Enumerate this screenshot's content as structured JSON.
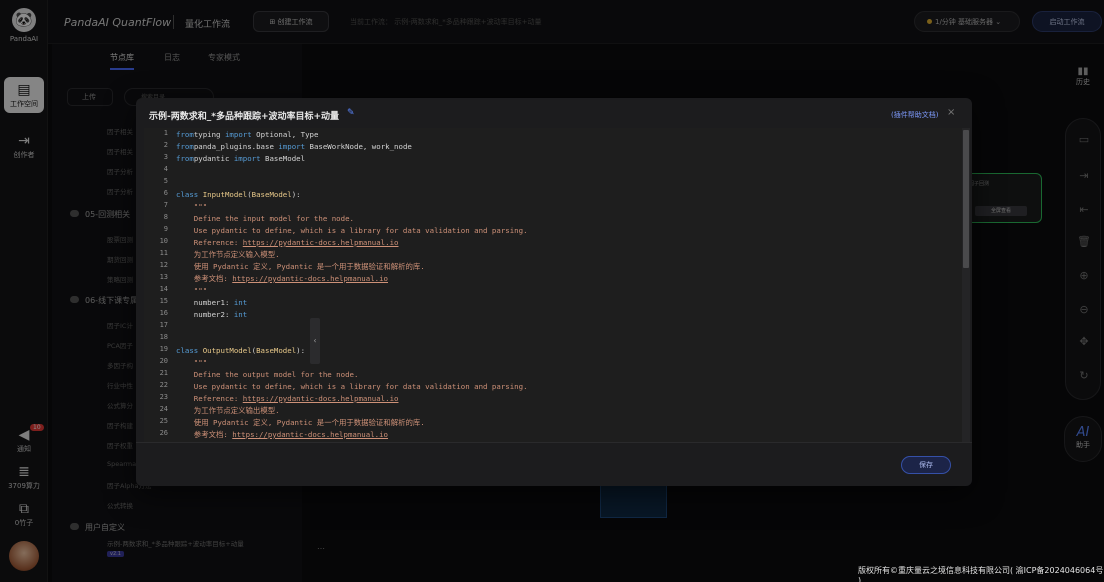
{
  "app": {
    "brand": "PandaAI",
    "title": "PandaAI QuantFlow",
    "subtitle": "量化工作流",
    "create_workflow": "创建工作流",
    "current_workflow": "当前工作流：  示例-两数求和_*多品种跟踪+波动率目标+动量",
    "server_label": "1/分钟  基础服务器",
    "start_workflow": "启动工作流"
  },
  "rail": {
    "workspace": "工作空间",
    "creator": "创作者",
    "notify": "通知",
    "notify_badge": "10",
    "compute": "3709算力",
    "bamboo": "0竹子"
  },
  "side": {
    "tabs": [
      "节点库",
      "日志",
      "专家模式"
    ],
    "upload": "上传",
    "search_placeholder": "搜索目录",
    "items_top": [
      "因子相关",
      "因子相关",
      "因子分析",
      "因子分析"
    ],
    "group_05": "05-回测相关",
    "items_05": [
      "股票回测",
      "期货回测",
      "策略回测"
    ],
    "group_06": "06-线下课专属",
    "items_06": [
      "因子IC计",
      "PCA因子",
      "多因子构",
      "行业中性",
      "公式算分",
      "因子构建",
      "因子权重",
      "Spearma",
      "因子Alpha方法",
      "公式转换"
    ],
    "group_user": "用户自定义",
    "user_item": "示例-两数求和_*多品种跟踪+波动率目标+动量",
    "user_tag": "v2.1",
    "more": "…"
  },
  "right": {
    "history": "历史",
    "assistant": "助手",
    "ai": "AI"
  },
  "canvas": {
    "node_title": "因子回测",
    "node_button": "全屏查看"
  },
  "footer": {
    "copyright": "版权所有©重庆量云之境信息科技有限公司( 渝ICP备2024046064号 )"
  },
  "modal": {
    "title": "示例-两数求和_*多品种跟踪+波动率目标+动量",
    "help": "(插件帮助文档)",
    "save": "保存",
    "close": "×",
    "edit": "✎",
    "collapse": "‹"
  },
  "code_lines": [
    [
      [
        "kw",
        "from"
      ],
      [
        "",
        "typing "
      ],
      [
        "kw",
        "import"
      ],
      [
        "",
        " Optional, Type"
      ]
    ],
    [
      [
        "kw",
        "from"
      ],
      [
        "",
        "panda_plugins.base "
      ],
      [
        "kw",
        "import"
      ],
      [
        "",
        " BaseWorkNode, work_node"
      ]
    ],
    [
      [
        "kw",
        "from"
      ],
      [
        "",
        "pydantic "
      ],
      [
        "kw",
        "import"
      ],
      [
        "",
        " BaseModel"
      ]
    ],
    [],
    [],
    [
      [
        "kw",
        "class"
      ],
      [
        "",
        " "
      ],
      [
        "cls",
        "InputModel"
      ],
      [
        "",
        "("
      ],
      [
        "cls",
        "BaseModel"
      ],
      [
        "",
        "):"
      ]
    ],
    [
      [
        "str",
        "    \"\"\""
      ]
    ],
    [
      [
        "str",
        "    Define the input model for the node."
      ]
    ],
    [
      [
        "str",
        "    Use pydantic to define, which is a library for data validation and parsing."
      ]
    ],
    [
      [
        "str",
        "    Reference: "
      ],
      [
        "url",
        "https://pydantic-docs.helpmanual.io"
      ]
    ],
    [
      [
        "str",
        "    为工作节点定义输入模型."
      ]
    ],
    [
      [
        "str",
        "    使用 Pydantic 定义, Pydantic 是一个用于数据验证和解析的库."
      ]
    ],
    [
      [
        "str",
        "    参考文档: "
      ],
      [
        "url",
        "https://pydantic-docs.helpmanual.io"
      ]
    ],
    [
      [
        "str",
        "    \"\"\""
      ]
    ],
    [
      [
        "",
        "    number1: "
      ],
      [
        "kw",
        "int"
      ]
    ],
    [
      [
        "",
        "    number2: "
      ],
      [
        "kw",
        "int"
      ]
    ],
    [],
    [],
    [
      [
        "kw",
        "class"
      ],
      [
        "",
        " "
      ],
      [
        "cls",
        "OutputModel"
      ],
      [
        "",
        "("
      ],
      [
        "cls",
        "BaseModel"
      ],
      [
        "",
        "):"
      ]
    ],
    [
      [
        "str",
        "    \"\"\""
      ]
    ],
    [
      [
        "str",
        "    Define the output model for the node."
      ]
    ],
    [
      [
        "str",
        "    Use pydantic to define, which is a library for data validation and parsing."
      ]
    ],
    [
      [
        "str",
        "    Reference: "
      ],
      [
        "url",
        "https://pydantic-docs.helpmanual.io"
      ]
    ],
    [
      [
        "str",
        "    为工作节点定义输出模型."
      ]
    ],
    [
      [
        "str",
        "    使用 Pydantic 定义, Pydantic 是一个用于数据验证和解析的库."
      ]
    ],
    [
      [
        "str",
        "    参考文档: "
      ],
      [
        "url",
        "https://pydantic-docs.helpmanual.io"
      ]
    ],
    [
      [
        "str",
        "    \"\"\""
      ]
    ]
  ],
  "colors": {
    "keyword": "#569cd6",
    "string": "#ce9178",
    "class": "#e8c98a",
    "node_border": "#2ebd5a",
    "accent": "#4a6cff"
  }
}
